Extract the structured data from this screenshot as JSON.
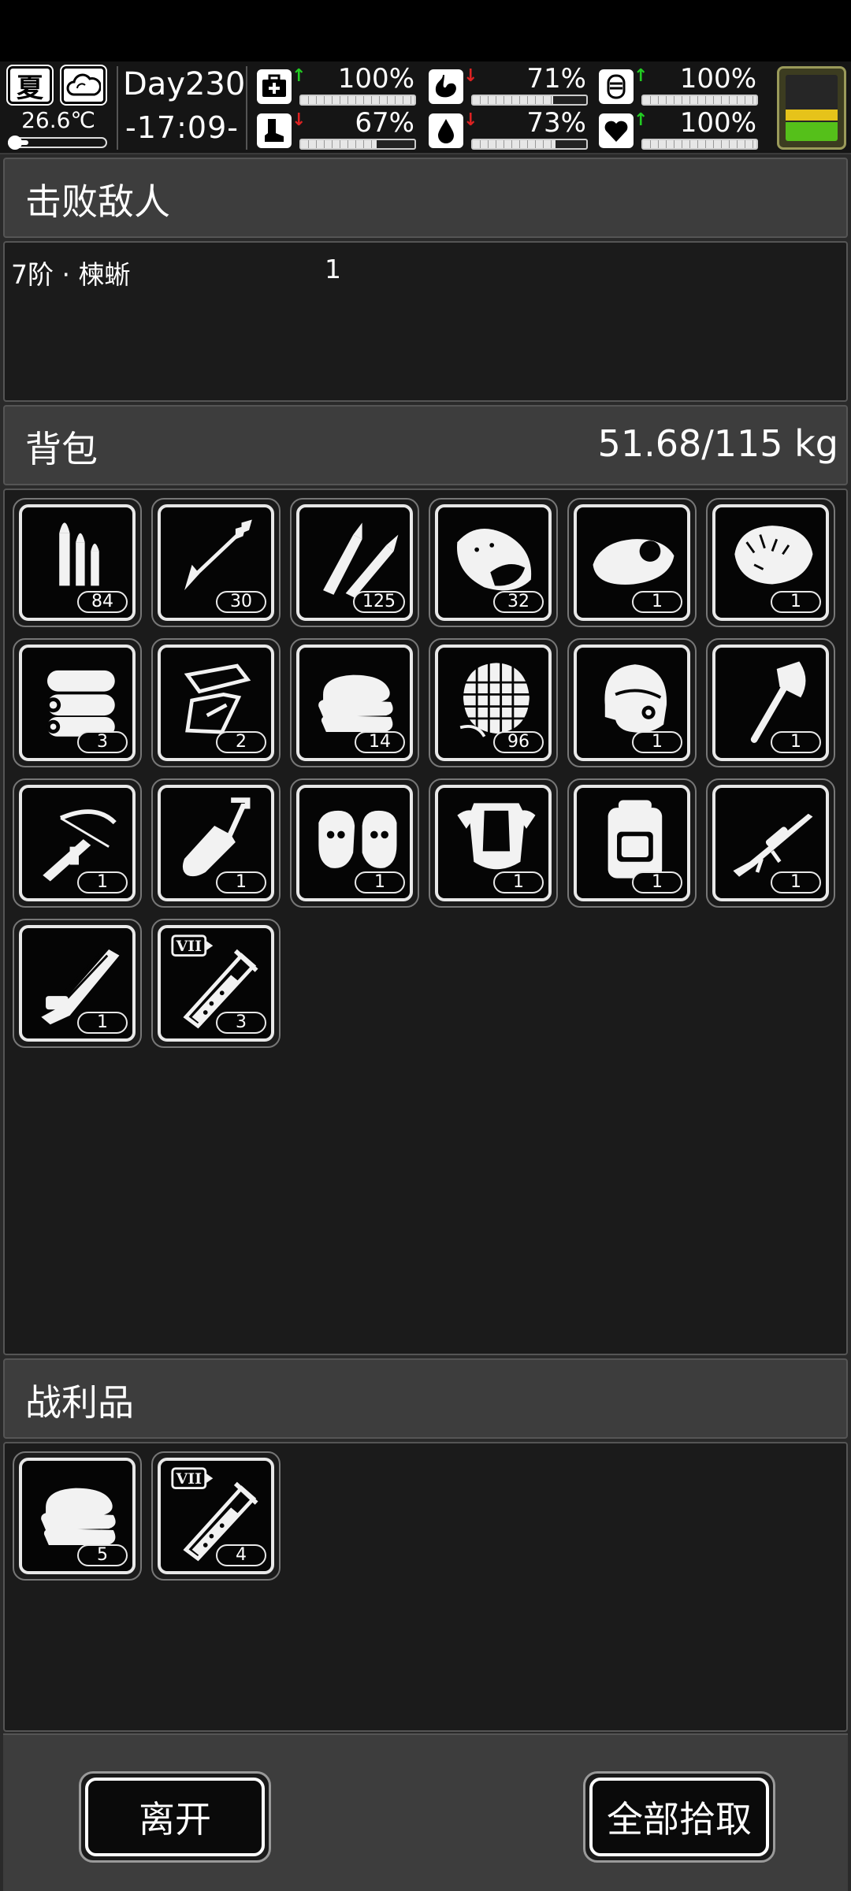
{
  "hud": {
    "season": "夏",
    "weather_icon": "cloud-icon",
    "temperature": "26.6℃",
    "temperature_level": 0.16,
    "day": "Day230",
    "time": "-17:09-",
    "stats": [
      {
        "id": "health",
        "icon": "medkit-icon",
        "trend": "up",
        "value": "100%",
        "level": 1.0
      },
      {
        "id": "hunger",
        "icon": "stomach-icon",
        "trend": "down",
        "value": "71%",
        "level": 0.71
      },
      {
        "id": "defense",
        "icon": "armor-icon",
        "trend": "up",
        "value": "100%",
        "level": 1.0
      },
      {
        "id": "stamina",
        "icon": "boot-icon",
        "trend": "down",
        "value": "67%",
        "level": 0.67
      },
      {
        "id": "thirst",
        "icon": "water-drop-icon",
        "trend": "down",
        "value": "73%",
        "level": 0.73
      },
      {
        "id": "mood",
        "icon": "heart-icon",
        "trend": "up",
        "value": "100%",
        "level": 1.0
      }
    ],
    "colors": {
      "up": "#22cc22",
      "down": "#dd2222",
      "battery_yellow": "#e6c31a",
      "battery_green": "#55c01a"
    }
  },
  "defeated": {
    "title": "击败敌人",
    "enemies": [
      {
        "name": "7阶 · 楝蜥",
        "count": "1"
      }
    ]
  },
  "backpack": {
    "title": "背包",
    "weight": "51.68/115 kg",
    "items": [
      {
        "icon": "bullets-icon",
        "count": "84"
      },
      {
        "icon": "arrow-icon",
        "count": "30"
      },
      {
        "icon": "rifle-rounds-icon",
        "count": "125"
      },
      {
        "icon": "raw-meat-icon",
        "count": "32"
      },
      {
        "icon": "egg-meat-icon",
        "count": "1"
      },
      {
        "icon": "fur-icon",
        "count": "1"
      },
      {
        "icon": "logs-icon",
        "count": "3"
      },
      {
        "icon": "paper-scraps-icon",
        "count": "2"
      },
      {
        "icon": "cloth-icon",
        "count": "14"
      },
      {
        "icon": "net-icon",
        "count": "96"
      },
      {
        "icon": "helmet-icon",
        "count": "1"
      },
      {
        "icon": "axe-icon",
        "count": "1"
      },
      {
        "icon": "crossbow-icon",
        "count": "1"
      },
      {
        "icon": "shovel-icon",
        "count": "1"
      },
      {
        "icon": "gloves-icon",
        "count": "1"
      },
      {
        "icon": "body-armor-icon",
        "count": "1"
      },
      {
        "icon": "backpack-icon",
        "count": "1"
      },
      {
        "icon": "sniper-rifle-icon",
        "count": "1"
      },
      {
        "icon": "minigun-icon",
        "count": "1"
      },
      {
        "icon": "test-tube-icon",
        "label": "VII",
        "count": "3"
      }
    ]
  },
  "loot": {
    "title": "战利品",
    "items": [
      {
        "icon": "cloth-icon",
        "count": "5"
      },
      {
        "icon": "test-tube-icon",
        "label": "VII",
        "count": "4"
      }
    ]
  },
  "buttons": {
    "leave": "离开",
    "take_all": "全部拾取"
  }
}
